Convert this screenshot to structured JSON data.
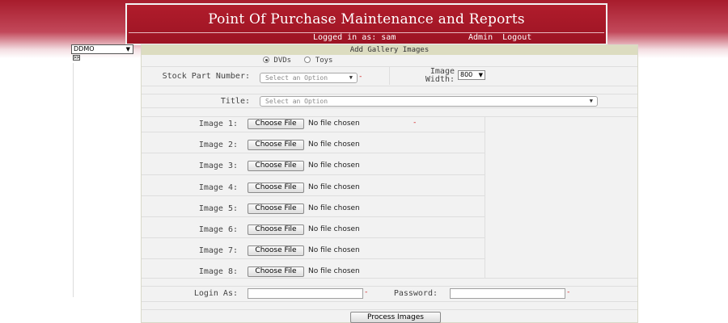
{
  "header": {
    "title": "Point Of Purchase Maintenance and Reports",
    "logged_in_text": "Logged in as: sam",
    "links": [
      "Admin",
      "Logout"
    ]
  },
  "sidebar": {
    "selected": "DDMO",
    "toggle_label": ">>"
  },
  "form": {
    "title": "Add Gallery Images",
    "product_types": [
      {
        "label": "DVDs",
        "checked": true
      },
      {
        "label": "Toys",
        "checked": false
      }
    ],
    "stock_part_label": "Stock Part Number:",
    "stock_part_placeholder": "Select an Option",
    "image_width_label_line1": "Image",
    "image_width_label_line2": "Width:",
    "image_width_value": "800",
    "title_label": "Title:",
    "title_placeholder": "Select an Option",
    "images": [
      {
        "label": "Image 1:",
        "button": "Choose File",
        "status": "No file chosen",
        "required": true
      },
      {
        "label": "Image 2:",
        "button": "Choose File",
        "status": "No file chosen",
        "required": false
      },
      {
        "label": "Image 3:",
        "button": "Choose File",
        "status": "No file chosen",
        "required": false
      },
      {
        "label": "Image 4:",
        "button": "Choose File",
        "status": "No file chosen",
        "required": false
      },
      {
        "label": "Image 5:",
        "button": "Choose File",
        "status": "No file chosen",
        "required": false
      },
      {
        "label": "Image 6:",
        "button": "Choose File",
        "status": "No file chosen",
        "required": false
      },
      {
        "label": "Image 7:",
        "button": "Choose File",
        "status": "No file chosen",
        "required": false
      },
      {
        "label": "Image 8:",
        "button": "Choose File",
        "status": "No file chosen",
        "required": false
      }
    ],
    "login_label": "Login As:",
    "password_label": "Password:",
    "login_value": "",
    "password_value": "",
    "required_mark": "-",
    "submit_label": "Process Images"
  }
}
